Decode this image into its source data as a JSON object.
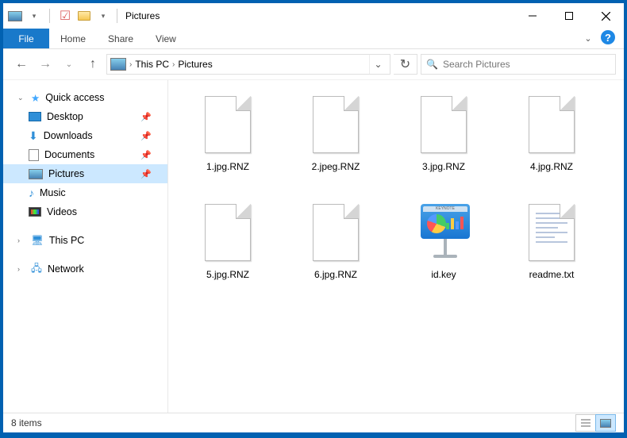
{
  "titlebar": {
    "title": "Pictures"
  },
  "ribbon": {
    "file": "File",
    "tabs": [
      "Home",
      "Share",
      "View"
    ]
  },
  "breadcrumbs": [
    "This PC",
    "Pictures"
  ],
  "search": {
    "placeholder": "Search Pictures"
  },
  "nav": {
    "quick_access": "Quick access",
    "items": [
      {
        "label": "Desktop",
        "pinned": true
      },
      {
        "label": "Downloads",
        "pinned": true
      },
      {
        "label": "Documents",
        "pinned": true
      },
      {
        "label": "Pictures",
        "pinned": true,
        "selected": true
      },
      {
        "label": "Music",
        "pinned": false
      },
      {
        "label": "Videos",
        "pinned": false
      }
    ],
    "this_pc": "This PC",
    "network": "Network"
  },
  "files": [
    {
      "name": "1.jpg.RNZ",
      "type": "blank"
    },
    {
      "name": "2.jpeg.RNZ",
      "type": "blank"
    },
    {
      "name": "3.jpg.RNZ",
      "type": "blank"
    },
    {
      "name": "4.jpg.RNZ",
      "type": "blank"
    },
    {
      "name": "5.jpg.RNZ",
      "type": "blank"
    },
    {
      "name": "6.jpg.RNZ",
      "type": "blank"
    },
    {
      "name": "id.key",
      "type": "keynote"
    },
    {
      "name": "readme.txt",
      "type": "text"
    }
  ],
  "status": {
    "count_text": "8 items"
  }
}
